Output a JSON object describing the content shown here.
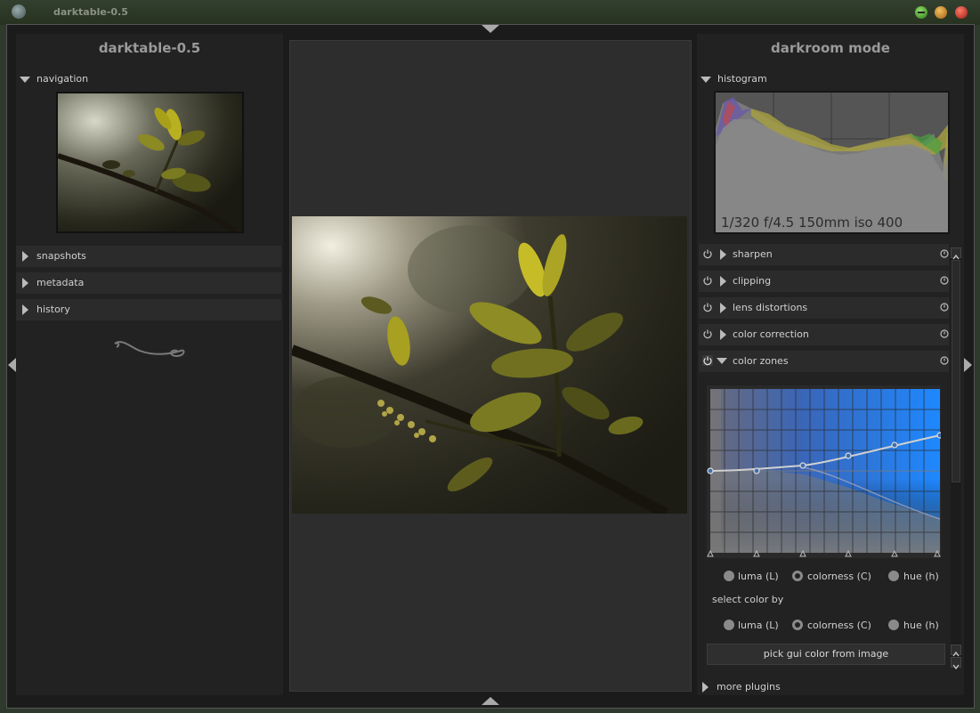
{
  "window": {
    "title": "darktable-0.5",
    "buttons": [
      "minimize",
      "maximize",
      "close"
    ]
  },
  "left_panel": {
    "title": "darktable-0.5",
    "navigation_label": "navigation",
    "sections": [
      {
        "label": "snapshots"
      },
      {
        "label": "metadata"
      },
      {
        "label": "history"
      }
    ]
  },
  "right_panel": {
    "title": "darkroom mode",
    "histogram_label": "histogram",
    "exif": "1/320 f/4.5 150mm iso 400",
    "plugins": [
      {
        "label": "sharpen",
        "expanded": false
      },
      {
        "label": "clipping",
        "expanded": false
      },
      {
        "label": "lens distortions",
        "expanded": false
      },
      {
        "label": "color correction",
        "expanded": false
      },
      {
        "label": "color zones",
        "expanded": true
      }
    ],
    "color_zones": {
      "channel_options": [
        "luma (L)",
        "colorness (C)",
        "hue (h)"
      ],
      "channel_selected": "colorness (C)",
      "select_color_by_label": "select color by",
      "select_by_options": [
        "luma (L)",
        "colorness (C)",
        "hue (h)"
      ],
      "select_by_selected": "colorness (C)",
      "pick_button": "pick gui color from image"
    },
    "more_plugins_label": "more plugins"
  },
  "icons": {
    "power": "power-icon",
    "preset": "preset-icon",
    "expand": "triangle-right-icon",
    "collapse": "triangle-down-icon"
  },
  "colors": {
    "background": "#1b1b1b",
    "panel": "#222222",
    "zone_blue": "#1e88ff"
  }
}
